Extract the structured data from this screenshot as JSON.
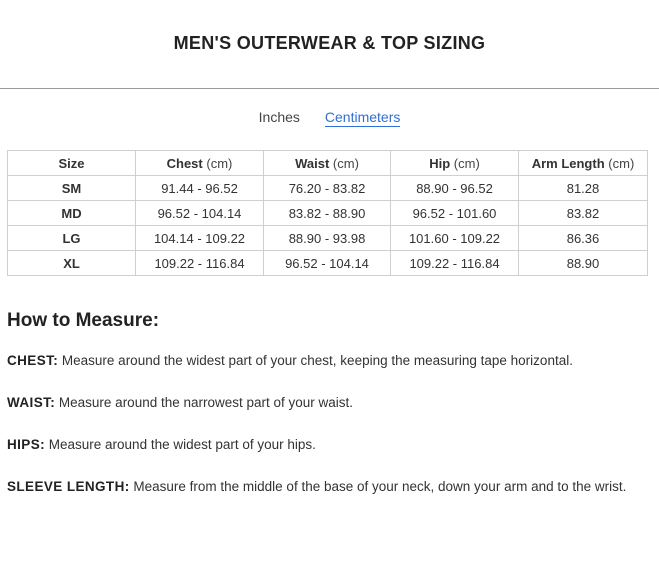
{
  "page": {
    "title": "MEN'S OUTERWEAR & TOP SIZING"
  },
  "unit_toggle": {
    "options": [
      {
        "label": "Inches",
        "active": false
      },
      {
        "label": "Centimeters",
        "active": true
      }
    ],
    "active_color": "#2f6fd6"
  },
  "size_table": {
    "columns": [
      {
        "label": "Size",
        "unit": ""
      },
      {
        "label": "Chest",
        "unit": "(cm)"
      },
      {
        "label": "Waist",
        "unit": "(cm)"
      },
      {
        "label": "Hip",
        "unit": "(cm)"
      },
      {
        "label": "Arm Length",
        "unit": "(cm)"
      }
    ],
    "rows": [
      [
        "SM",
        "91.44 - 96.52",
        "76.20 - 83.82",
        "88.90 - 96.52",
        "81.28"
      ],
      [
        "MD",
        "96.52 - 104.14",
        "83.82 - 88.90",
        "96.52 - 101.60",
        "83.82"
      ],
      [
        "LG",
        "104.14 - 109.22",
        "88.90 - 93.98",
        "101.60 - 109.22",
        "86.36"
      ],
      [
        "XL",
        "109.22 - 116.84",
        "96.52 - 104.14",
        "109.22 - 116.84",
        "88.90"
      ]
    ]
  },
  "how_to_measure": {
    "heading": "How to Measure:",
    "items": [
      {
        "term": "CHEST:",
        "text": " Measure around the widest part of your chest, keeping the measuring tape horizontal."
      },
      {
        "term": "WAIST:",
        "text": " Measure around the narrowest part of your waist."
      },
      {
        "term": "HIPS:",
        "text": " Measure around the widest part of your hips."
      },
      {
        "term": "SLEEVE LENGTH:",
        "text": " Measure from the middle of the base of your neck, down your arm and to the wrist."
      }
    ]
  }
}
